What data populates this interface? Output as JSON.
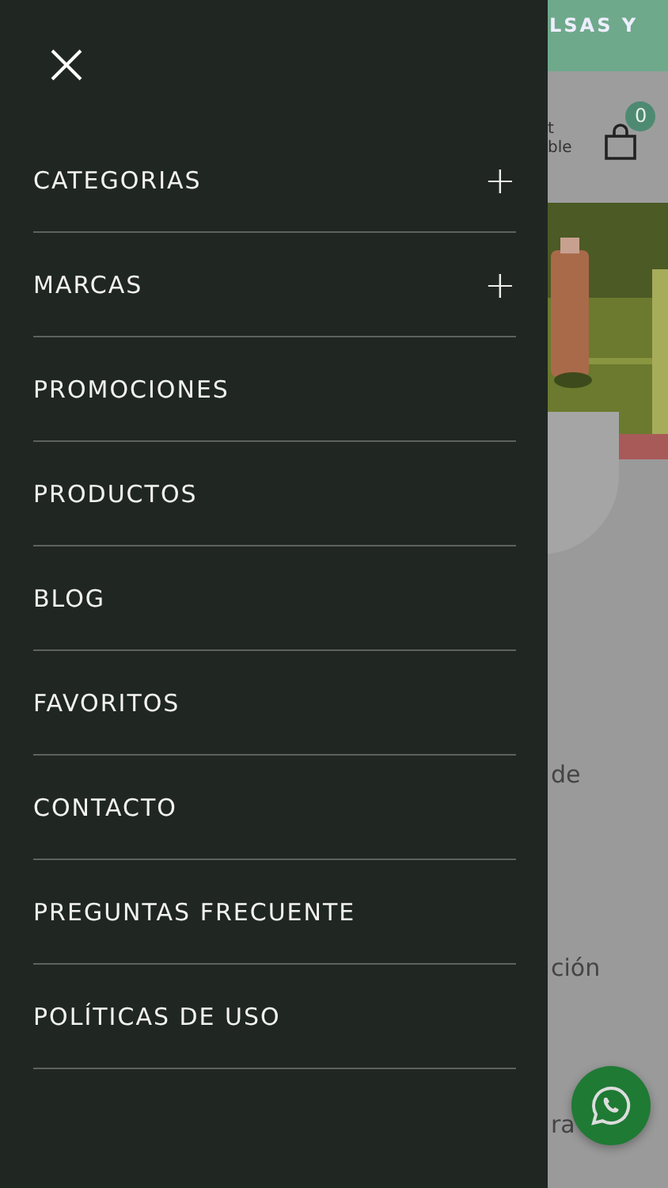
{
  "drawer": {
    "items": [
      {
        "label": "CATEGORIAS",
        "kind": "expandable",
        "expand_icon": "+"
      },
      {
        "label": "MARCAS",
        "kind": "expandable",
        "expand_icon": "+"
      },
      {
        "label": "PROMOCIONES",
        "kind": "link"
      },
      {
        "label": "PRODUCTOS",
        "kind": "link"
      },
      {
        "label": "BLOG",
        "kind": "link"
      },
      {
        "label": "FAVORITOS",
        "kind": "link"
      },
      {
        "label": "CONTACTO",
        "kind": "link"
      },
      {
        "label": "PREGUNTAS FRECUENTE",
        "kind": "link"
      },
      {
        "label": "POLÍTICAS DE USO",
        "kind": "link"
      }
    ]
  },
  "page": {
    "banner": "LSAS Y",
    "header_text": [
      "t",
      "ble"
    ],
    "cart_count": "0",
    "banner_picture": {
      "kind": "picture"
    },
    "texts": [
      "de",
      "ción",
      "ra"
    ]
  }
}
